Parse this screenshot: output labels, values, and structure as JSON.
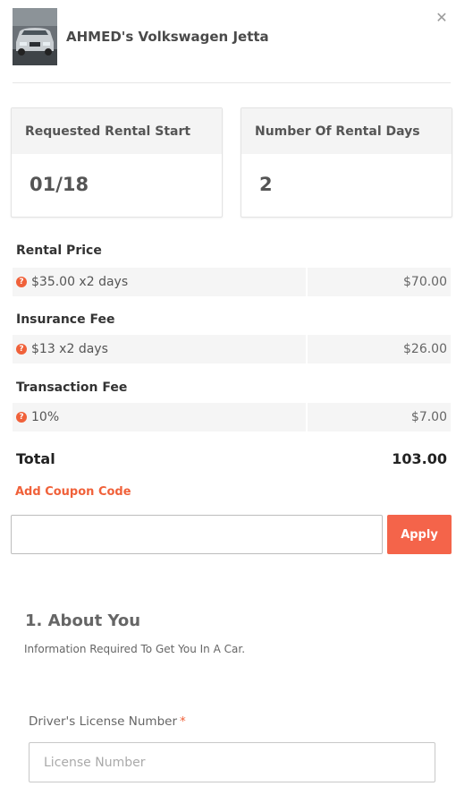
{
  "header": {
    "car_title": "AHMED's Volkswagen Jetta",
    "thumbnail_icon": "car-photo",
    "close_icon": "close-icon"
  },
  "summary": {
    "start_label": "Requested Rental Start",
    "start_value": "01/18",
    "days_label": "Number Of Rental Days",
    "days_value": "2"
  },
  "fees": [
    {
      "label": "Rental Price",
      "desc": "$35.00 x2 days",
      "amount": "$70.00"
    },
    {
      "label": "Insurance Fee",
      "desc": "$13 x2 days",
      "amount": "$26.00"
    },
    {
      "label": "Transaction Fee",
      "desc": "10%",
      "amount": "$7.00"
    }
  ],
  "total": {
    "label": "Total",
    "value": "103.00"
  },
  "coupon": {
    "link_label": "Add Coupon Code",
    "input_value": "",
    "input_placeholder": "",
    "apply_label": "Apply"
  },
  "about": {
    "title": "1. About You",
    "subtitle": "Information Required To Get You In A Car.",
    "license_label": "Driver's License Number",
    "required_mark": "*",
    "license_placeholder": "License Number"
  },
  "colors": {
    "accent": "#f0613a",
    "apply_button": "#f4644a",
    "row_background": "#f5f5f5",
    "card_header": "#f4f4f4"
  }
}
